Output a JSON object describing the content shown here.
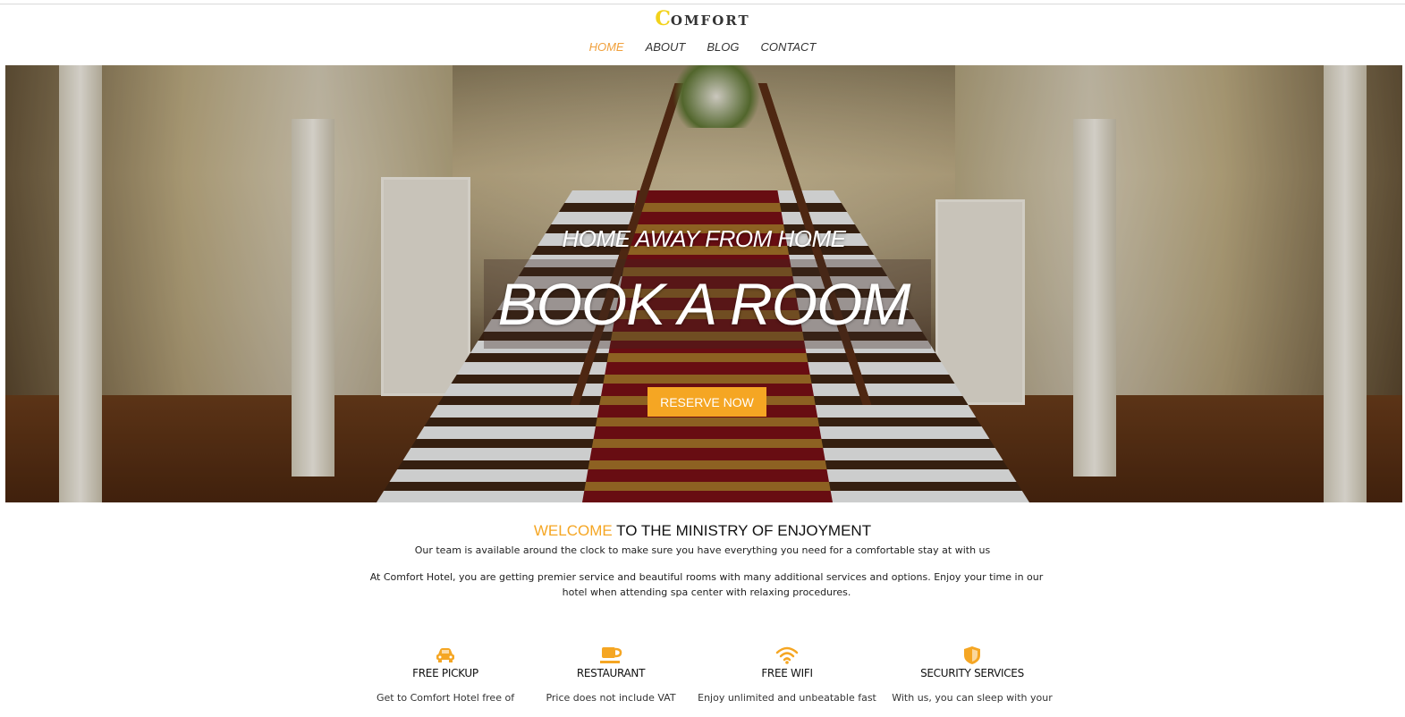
{
  "header": {
    "logo_initial": "C",
    "logo_rest": "OMFORT",
    "nav": [
      {
        "label": "HOME",
        "active": true
      },
      {
        "label": "ABOUT",
        "active": false
      },
      {
        "label": "BLOG",
        "active": false
      },
      {
        "label": "CONTACT",
        "active": false
      }
    ]
  },
  "hero": {
    "subtitle": "HOME AWAY FROM HOME",
    "title": "BOOK A ROOM",
    "button_label": "RESERVE NOW"
  },
  "welcome": {
    "title_accent": "WELCOME",
    "title_rest": " TO THE MINISTRY OF ENJOYMENT",
    "tagline": "Our team is available around the clock to make sure you have everything you need for a comfortable stay at with us",
    "about": "At Comfort Hotel, you are getting premier service and beautiful rooms with many additional services and options. Enjoy your time in our hotel when attending spa center with relaxing procedures."
  },
  "features": [
    {
      "icon": "car-icon",
      "label": "FREE PICKUP",
      "desc": "Get to Comfort Hotel free of"
    },
    {
      "icon": "coffee-cup-icon",
      "label": "RESTAURANT",
      "desc": "Price does not include VAT"
    },
    {
      "icon": "wifi-icon",
      "label": "FREE WIFI",
      "desc": "Enjoy unlimited and unbeatable fast"
    },
    {
      "icon": "shield-icon",
      "label": "SECURITY SERVICES",
      "desc": "With us, you can sleep with your"
    }
  ],
  "colors": {
    "accent": "#f5a623",
    "nav_active": "#f0a03c",
    "logo_initial": "#f2d21b"
  }
}
